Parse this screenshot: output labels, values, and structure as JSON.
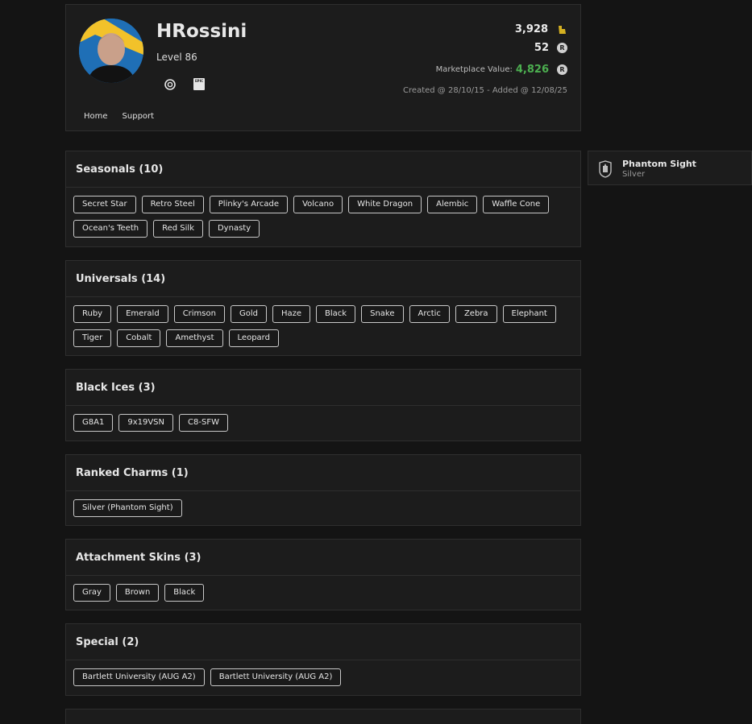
{
  "profile": {
    "username": "HRossini",
    "level": "Level 86",
    "renown": "3,928",
    "credits": "52",
    "marketplace_label": "Marketplace Value:",
    "marketplace_value": "4,826",
    "dates": "Created @ 28/10/15 - Added @ 12/08/25",
    "coin_glyph": "R",
    "platforms": [
      "ubisoft-icon",
      "epic-games-icon"
    ],
    "epic_text": "EPIC",
    "nav": [
      "Home",
      "Support"
    ]
  },
  "side_card": {
    "title": "Phantom Sight",
    "subtitle": "Silver"
  },
  "sections": [
    {
      "title": "Seasonals (10)",
      "items": [
        "Secret Star",
        "Retro Steel",
        "Plinky's Arcade",
        "Volcano",
        "White Dragon",
        "Alembic",
        "Waffle Cone",
        "Ocean's Teeth",
        "Red Silk",
        "Dynasty"
      ]
    },
    {
      "title": "Universals (14)",
      "items": [
        "Ruby",
        "Emerald",
        "Crimson",
        "Gold",
        "Haze",
        "Black",
        "Snake",
        "Arctic",
        "Zebra",
        "Elephant",
        "Tiger",
        "Cobalt",
        "Amethyst",
        "Leopard"
      ]
    },
    {
      "title": "Black Ices (3)",
      "items": [
        "G8A1",
        "9x19VSN",
        "C8-SFW"
      ]
    },
    {
      "title": "Ranked Charms (1)",
      "items": [
        "Silver (Phantom Sight)"
      ]
    },
    {
      "title": "Attachment Skins (3)",
      "items": [
        "Gray",
        "Brown",
        "Black"
      ]
    },
    {
      "title": "Special (2)",
      "items": [
        "Bartlett University (AUG A2)",
        "Bartlett University (AUG A2)"
      ]
    }
  ],
  "colors": {
    "accent_green": "#4caf50",
    "background": "#141414",
    "panel": "#1c1c1c"
  }
}
